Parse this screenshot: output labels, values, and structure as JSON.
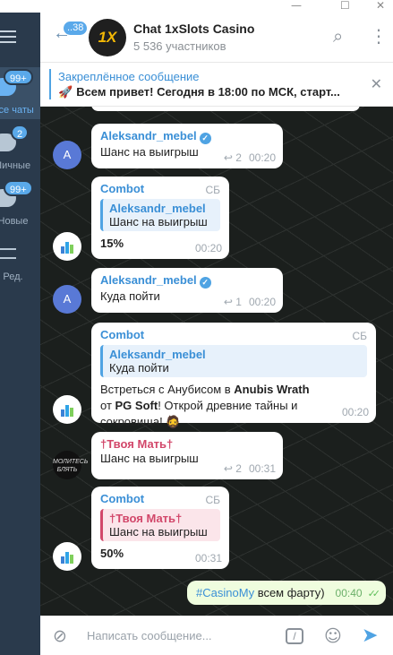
{
  "window": {
    "minimize": "—",
    "maximize": "☐",
    "close": "✕"
  },
  "sidebar": {
    "folders": [
      {
        "label": "Все чаты",
        "badge": "99+"
      },
      {
        "label": "Личные",
        "badge": "2"
      },
      {
        "label": "Новые",
        "badge": "99+"
      },
      {
        "label": "Ред."
      }
    ]
  },
  "header": {
    "back_badge": "..38",
    "avatar_text": "1X",
    "title": "Chat 1xSlots Casino",
    "subtitle": "5 536 участников"
  },
  "pinned": {
    "title": "Закреплённое сообщение",
    "icon": "🚀",
    "text": "Всем привет! Сегодня в 18:00 по МСК, старт..."
  },
  "messages": [
    {
      "author": "Aleksandr_mebel",
      "avatar": "A",
      "text": "Шанс на выигрыш",
      "replies": "2",
      "time": "00:20"
    },
    {
      "author": "Combot",
      "tag": "СБ",
      "quote_author": "Aleksandr_mebel",
      "quote_text": "Шанс на выигрыш",
      "text": "15%",
      "time": "00:20"
    },
    {
      "author": "Aleksandr_mebel",
      "avatar": "A",
      "text": "Куда пойти",
      "replies": "1",
      "time": "00:20"
    },
    {
      "author": "Combot",
      "tag": "СБ",
      "quote_author": "Aleksandr_mebel",
      "quote_text": "Куда пойти",
      "text_parts": [
        "Встреться с Анубисом в ",
        "Anubis Wrath",
        " от ",
        "PG Soft",
        "! Открой древние тайны и сокровища! ",
        "🧔"
      ],
      "time": "00:20"
    },
    {
      "author": "†Твоя Мать†",
      "avatar": "МОЛИТЕСЬ БЛЯТЬ",
      "text": "Шанс на выигрыш",
      "replies": "2",
      "time": "00:31"
    },
    {
      "author": "Combot",
      "tag": "СБ",
      "quote_author": "†Твоя Мать†",
      "quote_text": "Шанс на выигрыш",
      "text": "50%",
      "time": "00:31"
    }
  ],
  "own_message": {
    "hashtag": "#CasinoMy",
    "text": " всем фарту)",
    "time": "00:40",
    "ticks": "✓✓"
  },
  "input": {
    "placeholder": "Написать сообщение..."
  },
  "colors": {
    "accent": "#4fa3e3",
    "name_red": "#d2476a",
    "own_bubble": "#effdde"
  }
}
